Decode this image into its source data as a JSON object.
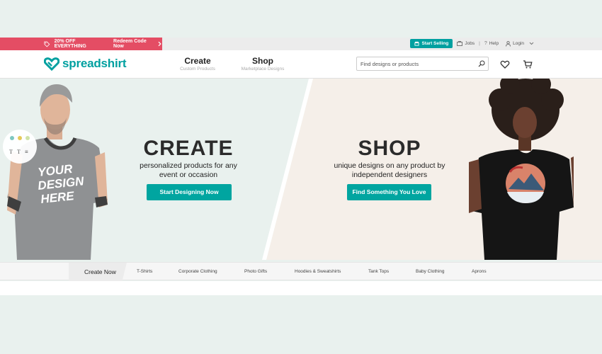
{
  "promo": {
    "text": "20% OFF EVERYTHING",
    "code_link": "Redeem Code Now"
  },
  "utility": {
    "sell": "Start Selling",
    "jobs": "Jobs",
    "help": "Help",
    "login": "Login",
    "sep": "|"
  },
  "header": {
    "logo": "spreadshirt",
    "nav": [
      {
        "title": "Create",
        "sub": "Custom Products"
      },
      {
        "title": "Shop",
        "sub": "Marketplace Designs"
      }
    ],
    "search_placeholder": "Find designs or products"
  },
  "hero": {
    "create": {
      "title": "CREATE",
      "line1": "personalized products for any",
      "line2": "event or occasion",
      "button": "Start Designing Now"
    },
    "shop": {
      "title": "SHOP",
      "line1": "unique designs on any product by",
      "line2": "independent designers",
      "button": "Find Something You Love"
    },
    "shirt_text": [
      "YOUR",
      "DESIGN",
      "HERE"
    ]
  },
  "categories": [
    "Create Now",
    "T-Shirts",
    "Corporate Clothing",
    "Photo Gifts",
    "Hoodies & Sweatshirts",
    "Tank Tops",
    "Baby Clothing",
    "Aprons"
  ],
  "colors": {
    "brand": "#00a0a0",
    "promo": "#e44d64",
    "button": "#00a5a0"
  }
}
